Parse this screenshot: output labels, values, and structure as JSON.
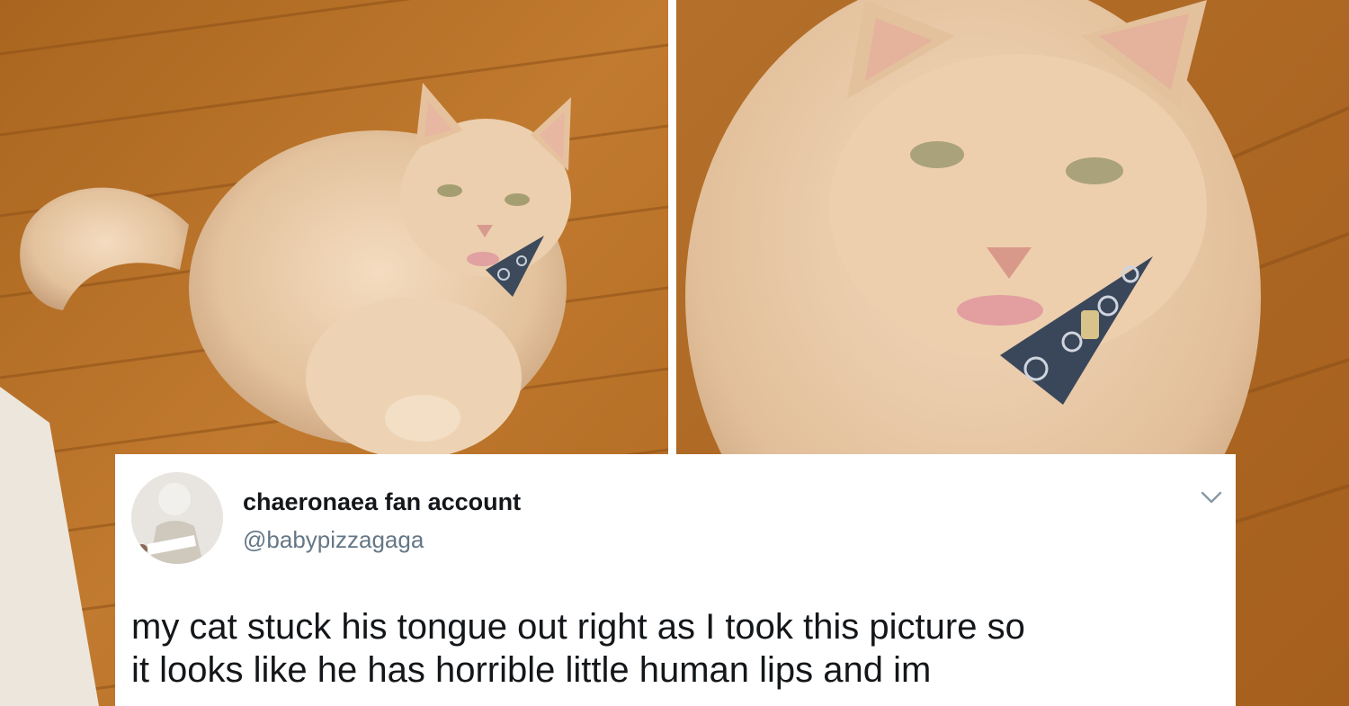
{
  "tweet": {
    "author_name": "chaeronaea fan account",
    "author_handle": "@babypizzagaga",
    "text_line_1": "my cat stuck his tongue out right as I took this picture so",
    "text_line_2": "it looks like he has horrible little human lips and im"
  },
  "icons": {
    "menu": "chevron-down-icon"
  },
  "colors": {
    "floor": "#b8742c",
    "cat_fur": "#e8c9a6",
    "name_text": "#14171a",
    "handle_text": "#657786",
    "chevron": "#8899a6"
  }
}
